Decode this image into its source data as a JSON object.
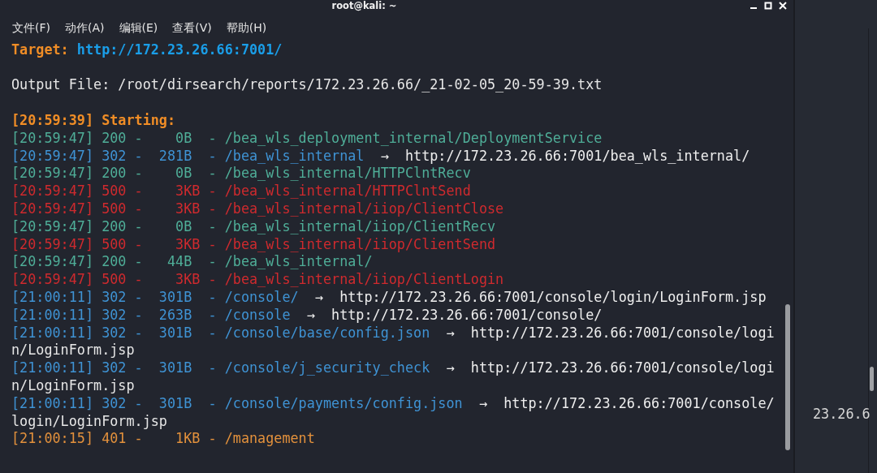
{
  "window": {
    "title": "root@kali: ~"
  },
  "menu": [
    "文件(F)",
    "动作(A)",
    "编辑(E)",
    "查看(V)",
    "帮助(H)"
  ],
  "target": {
    "label": "Target:",
    "url": "http://172.23.26.66:7001/"
  },
  "output_file": "Output File: /root/dirsearch/reports/172.23.26.66/_21-02-05_20-59-39.txt",
  "start": "[20:59:39] Starting:",
  "lines": [
    {
      "kind": "ok",
      "text": "[20:59:47] 200 -    0B  - /bea_wls_deployment_internal/DeploymentService"
    },
    {
      "kind": "redirect",
      "text": "[20:59:47] 302 -  281B  - /bea_wls_internal",
      "target": "→  http://172.23.26.66:7001/bea_wls_internal/"
    },
    {
      "kind": "ok",
      "text": "[20:59:47] 200 -    0B  - /bea_wls_internal/HTTPClntRecv"
    },
    {
      "kind": "error",
      "text": "[20:59:47] 500 -    3KB - /bea_wls_internal/HTTPClntSend"
    },
    {
      "kind": "error",
      "text": "[20:59:47] 500 -    3KB - /bea_wls_internal/iiop/ClientClose"
    },
    {
      "kind": "ok",
      "text": "[20:59:47] 200 -    0B  - /bea_wls_internal/iiop/ClientRecv"
    },
    {
      "kind": "error",
      "text": "[20:59:47] 500 -    3KB - /bea_wls_internal/iiop/ClientSend"
    },
    {
      "kind": "ok",
      "text": "[20:59:47] 200 -   44B  - /bea_wls_internal/"
    },
    {
      "kind": "error",
      "text": "[20:59:47] 500 -    3KB - /bea_wls_internal/iiop/ClientLogin"
    },
    {
      "kind": "redirect",
      "text": "[21:00:11] 302 -  301B  - /console/",
      "target": "→  http://172.23.26.66:7001/console/login/LoginForm.jsp"
    },
    {
      "kind": "redirect",
      "text": "[21:00:11] 302 -  263B  - /console",
      "target": "→  http://172.23.26.66:7001/console/"
    },
    {
      "kind": "redirect",
      "text": "[21:00:11] 302 -  301B  - /console/base/config.json",
      "target": "→  http://172.23.26.66:7001/console/logi"
    },
    {
      "kind": "continuation",
      "text": "n/LoginForm.jsp"
    },
    {
      "kind": "redirect",
      "text": "[21:00:11] 302 -  301B  - /console/j_security_check",
      "target": "→  http://172.23.26.66:7001/console/logi"
    },
    {
      "kind": "continuation",
      "text": "n/LoginForm.jsp"
    },
    {
      "kind": "redirect",
      "text": "[21:00:11] 302 -  301B  - /console/payments/config.json",
      "target": "→  http://172.23.26.66:7001/console/"
    },
    {
      "kind": "continuation",
      "text": "login/LoginForm.jsp"
    },
    {
      "kind": "auth",
      "text": "[21:00:15] 401 -    1KB - /management"
    }
  ],
  "side_window": {
    "text": "23.26.6"
  }
}
